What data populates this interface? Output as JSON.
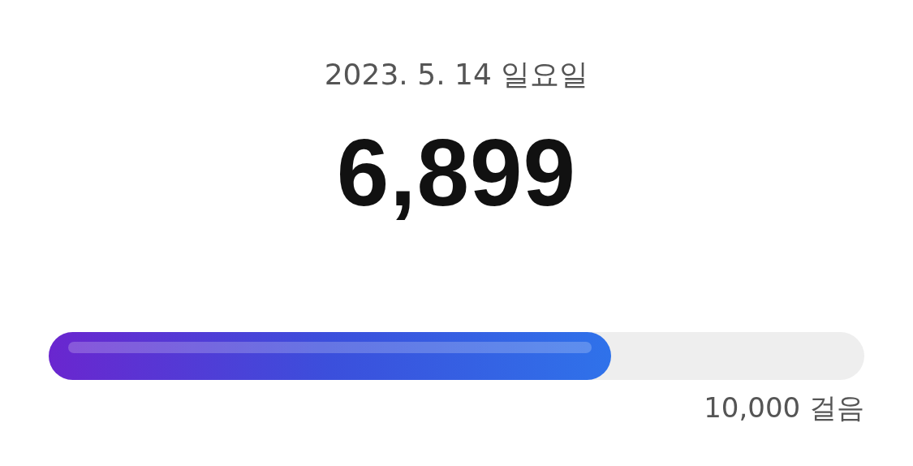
{
  "date": "2023. 5. 14 일요일",
  "steps": "6,899",
  "progress": {
    "level": 0.6899
  },
  "goal": "10,000 걸음"
}
